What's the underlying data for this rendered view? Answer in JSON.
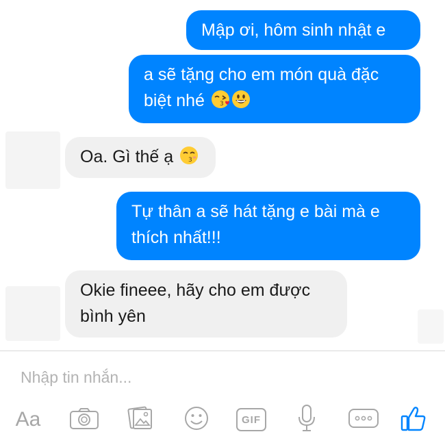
{
  "messages": [
    {
      "direction": "outgoing",
      "lines": [
        "Mập ơi, hôm sinh nhật e"
      ]
    },
    {
      "direction": "outgoing",
      "lines": [
        "a sẽ tặng cho em món quà đặc",
        "biệt nhé"
      ],
      "emojis": [
        "kissing-heart-emoji",
        "grinning-emoji"
      ]
    },
    {
      "direction": "incoming",
      "lines": [
        "Oa. Gì thế ạ"
      ],
      "emojis": [
        "kissing-closed-eyes-emoji"
      ]
    },
    {
      "direction": "outgoing",
      "lines": [
        "Tự thân a sẽ hát tặng e bài mà e",
        "thích nhất!!!"
      ]
    },
    {
      "direction": "incoming",
      "lines": [
        "Okie fineee, hãy cho em được",
        "bình yên"
      ]
    }
  ],
  "composer": {
    "placeholder": "Nhập tin nhắn...",
    "aa_label": "Aa",
    "gif_label": "GIF",
    "tools": [
      "text-format",
      "camera-icon",
      "gallery-icon",
      "sticker-smiley-icon",
      "gif-icon",
      "microphone-icon",
      "more-icon",
      "like-thumbs-up-icon"
    ]
  },
  "colors": {
    "outgoing_bubble": "#0084ff",
    "incoming_bubble": "#f0f0f0",
    "toolbar_icon": "#a7a7a7",
    "like_icon": "#0084ff"
  }
}
